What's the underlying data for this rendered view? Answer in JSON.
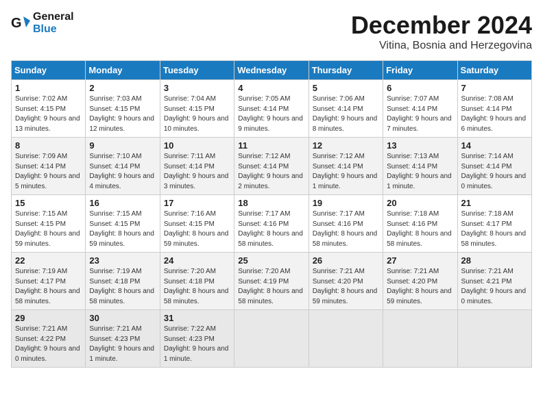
{
  "header": {
    "logo_line1": "General",
    "logo_line2": "Blue",
    "month": "December 2024",
    "location": "Vitina, Bosnia and Herzegovina"
  },
  "weekdays": [
    "Sunday",
    "Monday",
    "Tuesday",
    "Wednesday",
    "Thursday",
    "Friday",
    "Saturday"
  ],
  "weeks": [
    [
      {
        "day": "1",
        "sunrise": "Sunrise: 7:02 AM",
        "sunset": "Sunset: 4:15 PM",
        "daylight": "Daylight: 9 hours and 13 minutes."
      },
      {
        "day": "2",
        "sunrise": "Sunrise: 7:03 AM",
        "sunset": "Sunset: 4:15 PM",
        "daylight": "Daylight: 9 hours and 12 minutes."
      },
      {
        "day": "3",
        "sunrise": "Sunrise: 7:04 AM",
        "sunset": "Sunset: 4:15 PM",
        "daylight": "Daylight: 9 hours and 10 minutes."
      },
      {
        "day": "4",
        "sunrise": "Sunrise: 7:05 AM",
        "sunset": "Sunset: 4:14 PM",
        "daylight": "Daylight: 9 hours and 9 minutes."
      },
      {
        "day": "5",
        "sunrise": "Sunrise: 7:06 AM",
        "sunset": "Sunset: 4:14 PM",
        "daylight": "Daylight: 9 hours and 8 minutes."
      },
      {
        "day": "6",
        "sunrise": "Sunrise: 7:07 AM",
        "sunset": "Sunset: 4:14 PM",
        "daylight": "Daylight: 9 hours and 7 minutes."
      },
      {
        "day": "7",
        "sunrise": "Sunrise: 7:08 AM",
        "sunset": "Sunset: 4:14 PM",
        "daylight": "Daylight: 9 hours and 6 minutes."
      }
    ],
    [
      {
        "day": "8",
        "sunrise": "Sunrise: 7:09 AM",
        "sunset": "Sunset: 4:14 PM",
        "daylight": "Daylight: 9 hours and 5 minutes."
      },
      {
        "day": "9",
        "sunrise": "Sunrise: 7:10 AM",
        "sunset": "Sunset: 4:14 PM",
        "daylight": "Daylight: 9 hours and 4 minutes."
      },
      {
        "day": "10",
        "sunrise": "Sunrise: 7:11 AM",
        "sunset": "Sunset: 4:14 PM",
        "daylight": "Daylight: 9 hours and 3 minutes."
      },
      {
        "day": "11",
        "sunrise": "Sunrise: 7:12 AM",
        "sunset": "Sunset: 4:14 PM",
        "daylight": "Daylight: 9 hours and 2 minutes."
      },
      {
        "day": "12",
        "sunrise": "Sunrise: 7:12 AM",
        "sunset": "Sunset: 4:14 PM",
        "daylight": "Daylight: 9 hours and 1 minute."
      },
      {
        "day": "13",
        "sunrise": "Sunrise: 7:13 AM",
        "sunset": "Sunset: 4:14 PM",
        "daylight": "Daylight: 9 hours and 1 minute."
      },
      {
        "day": "14",
        "sunrise": "Sunrise: 7:14 AM",
        "sunset": "Sunset: 4:14 PM",
        "daylight": "Daylight: 9 hours and 0 minutes."
      }
    ],
    [
      {
        "day": "15",
        "sunrise": "Sunrise: 7:15 AM",
        "sunset": "Sunset: 4:15 PM",
        "daylight": "Daylight: 8 hours and 59 minutes."
      },
      {
        "day": "16",
        "sunrise": "Sunrise: 7:15 AM",
        "sunset": "Sunset: 4:15 PM",
        "daylight": "Daylight: 8 hours and 59 minutes."
      },
      {
        "day": "17",
        "sunrise": "Sunrise: 7:16 AM",
        "sunset": "Sunset: 4:15 PM",
        "daylight": "Daylight: 8 hours and 59 minutes."
      },
      {
        "day": "18",
        "sunrise": "Sunrise: 7:17 AM",
        "sunset": "Sunset: 4:16 PM",
        "daylight": "Daylight: 8 hours and 58 minutes."
      },
      {
        "day": "19",
        "sunrise": "Sunrise: 7:17 AM",
        "sunset": "Sunset: 4:16 PM",
        "daylight": "Daylight: 8 hours and 58 minutes."
      },
      {
        "day": "20",
        "sunrise": "Sunrise: 7:18 AM",
        "sunset": "Sunset: 4:16 PM",
        "daylight": "Daylight: 8 hours and 58 minutes."
      },
      {
        "day": "21",
        "sunrise": "Sunrise: 7:18 AM",
        "sunset": "Sunset: 4:17 PM",
        "daylight": "Daylight: 8 hours and 58 minutes."
      }
    ],
    [
      {
        "day": "22",
        "sunrise": "Sunrise: 7:19 AM",
        "sunset": "Sunset: 4:17 PM",
        "daylight": "Daylight: 8 hours and 58 minutes."
      },
      {
        "day": "23",
        "sunrise": "Sunrise: 7:19 AM",
        "sunset": "Sunset: 4:18 PM",
        "daylight": "Daylight: 8 hours and 58 minutes."
      },
      {
        "day": "24",
        "sunrise": "Sunrise: 7:20 AM",
        "sunset": "Sunset: 4:18 PM",
        "daylight": "Daylight: 8 hours and 58 minutes."
      },
      {
        "day": "25",
        "sunrise": "Sunrise: 7:20 AM",
        "sunset": "Sunset: 4:19 PM",
        "daylight": "Daylight: 8 hours and 58 minutes."
      },
      {
        "day": "26",
        "sunrise": "Sunrise: 7:21 AM",
        "sunset": "Sunset: 4:20 PM",
        "daylight": "Daylight: 8 hours and 59 minutes."
      },
      {
        "day": "27",
        "sunrise": "Sunrise: 7:21 AM",
        "sunset": "Sunset: 4:20 PM",
        "daylight": "Daylight: 8 hours and 59 minutes."
      },
      {
        "day": "28",
        "sunrise": "Sunrise: 7:21 AM",
        "sunset": "Sunset: 4:21 PM",
        "daylight": "Daylight: 9 hours and 0 minutes."
      }
    ],
    [
      {
        "day": "29",
        "sunrise": "Sunrise: 7:21 AM",
        "sunset": "Sunset: 4:22 PM",
        "daylight": "Daylight: 9 hours and 0 minutes."
      },
      {
        "day": "30",
        "sunrise": "Sunrise: 7:21 AM",
        "sunset": "Sunset: 4:23 PM",
        "daylight": "Daylight: 9 hours and 1 minute."
      },
      {
        "day": "31",
        "sunrise": "Sunrise: 7:22 AM",
        "sunset": "Sunset: 4:23 PM",
        "daylight": "Daylight: 9 hours and 1 minute."
      },
      null,
      null,
      null,
      null
    ]
  ]
}
